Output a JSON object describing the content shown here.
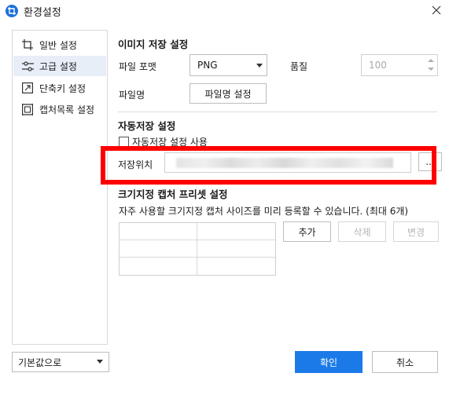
{
  "window": {
    "title": "환경설정",
    "close_label": "✕"
  },
  "sidebar": {
    "items": [
      {
        "label": "일반 설정",
        "icon": "crop-icon",
        "active": false
      },
      {
        "label": "고급 설정",
        "icon": "sliders-icon",
        "active": true
      },
      {
        "label": "단축키 설정",
        "icon": "shortcut-icon",
        "active": false
      },
      {
        "label": "캡처목록 설정",
        "icon": "capture-list-icon",
        "active": false
      }
    ],
    "defaults_select": "기본값으로"
  },
  "image_save": {
    "title": "이미지 저장 설정",
    "format_label": "파일 포맷",
    "format_value": "PNG",
    "quality_label": "품질",
    "quality_value": "100",
    "filename_label": "파일명",
    "filename_button": "파일명 설정"
  },
  "auto_save": {
    "title": "자동저장 설정",
    "checkbox_label": "자동저장 설정 사용",
    "checked": false,
    "location_label": "저장위치",
    "browse_label": "..."
  },
  "preset": {
    "title": "크기지정 캡처 프리셋 설정",
    "description": "자주 사용할 크기지정 캡처 사이즈를 미리 등록할 수 있습니다. (최대 6개)",
    "add_button": "추가",
    "delete_button": "삭제",
    "edit_button": "변경"
  },
  "footer": {
    "ok_button": "확인",
    "cancel_button": "취소"
  },
  "colors": {
    "accent": "#1b7ae8",
    "highlight_box": "#ff0000",
    "sidebar_active": "#e7eef8"
  }
}
